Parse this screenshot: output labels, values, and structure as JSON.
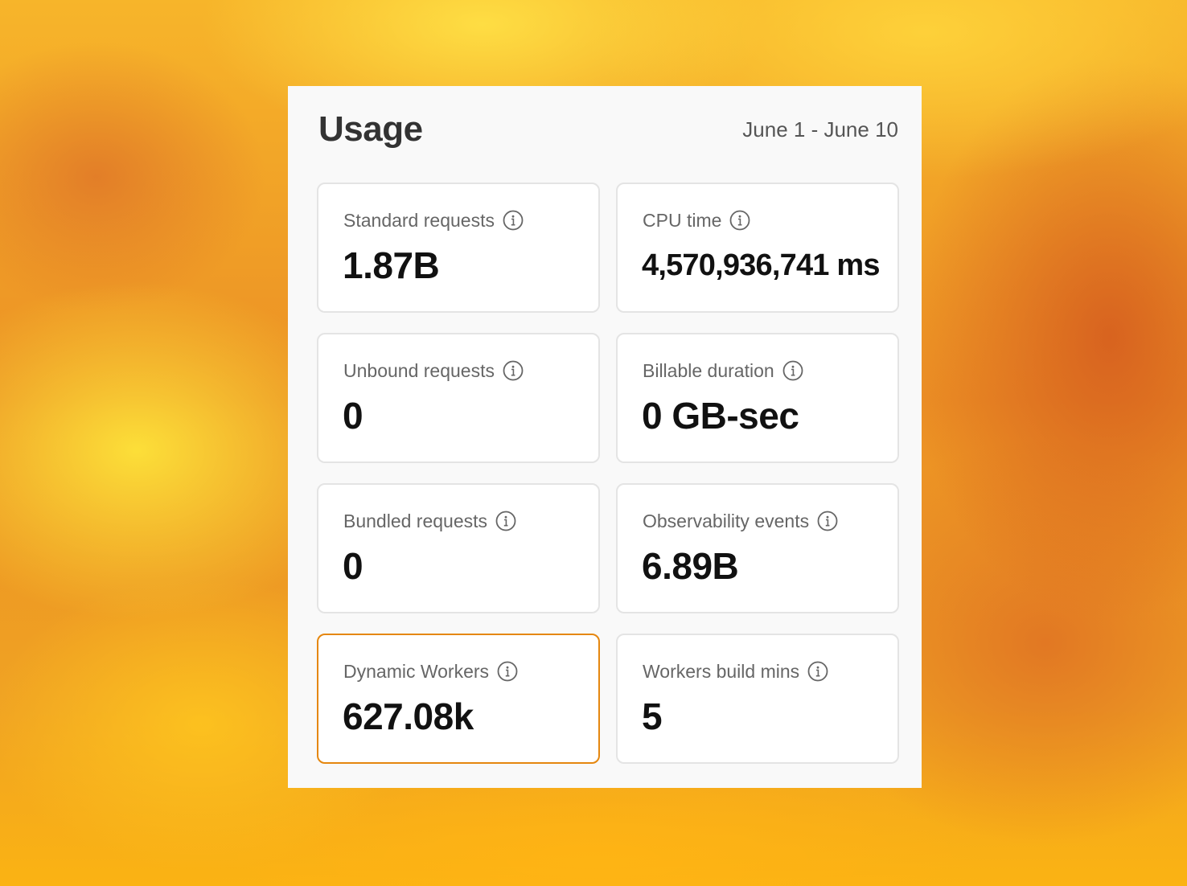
{
  "usage_card": {
    "title": "Usage",
    "date_range": "June 1 - June 10",
    "metrics": [
      {
        "label": "Standard requests",
        "value": "1.87B",
        "icon": "info-icon"
      },
      {
        "label": "CPU time",
        "value": "4,570,936,741 ms",
        "icon": "info-icon"
      },
      {
        "label": "Unbound requests",
        "value": "0",
        "icon": "info-icon"
      },
      {
        "label": "Billable duration",
        "value": "0 GB-sec",
        "icon": "info-icon"
      },
      {
        "label": "Bundled requests",
        "value": "0",
        "icon": "info-icon"
      },
      {
        "label": "Observability events",
        "value": "6.89B",
        "icon": "info-icon"
      },
      {
        "label": "Dynamic Workers",
        "value": "627.08k",
        "icon": "info-icon",
        "highlighted": true
      },
      {
        "label": "Workers build mins",
        "value": "5",
        "icon": "info-icon"
      }
    ]
  },
  "colors": {
    "highlight_border": "#e5870f",
    "tile_border": "#e4e4e4",
    "card_background": "#f9f9f9"
  }
}
